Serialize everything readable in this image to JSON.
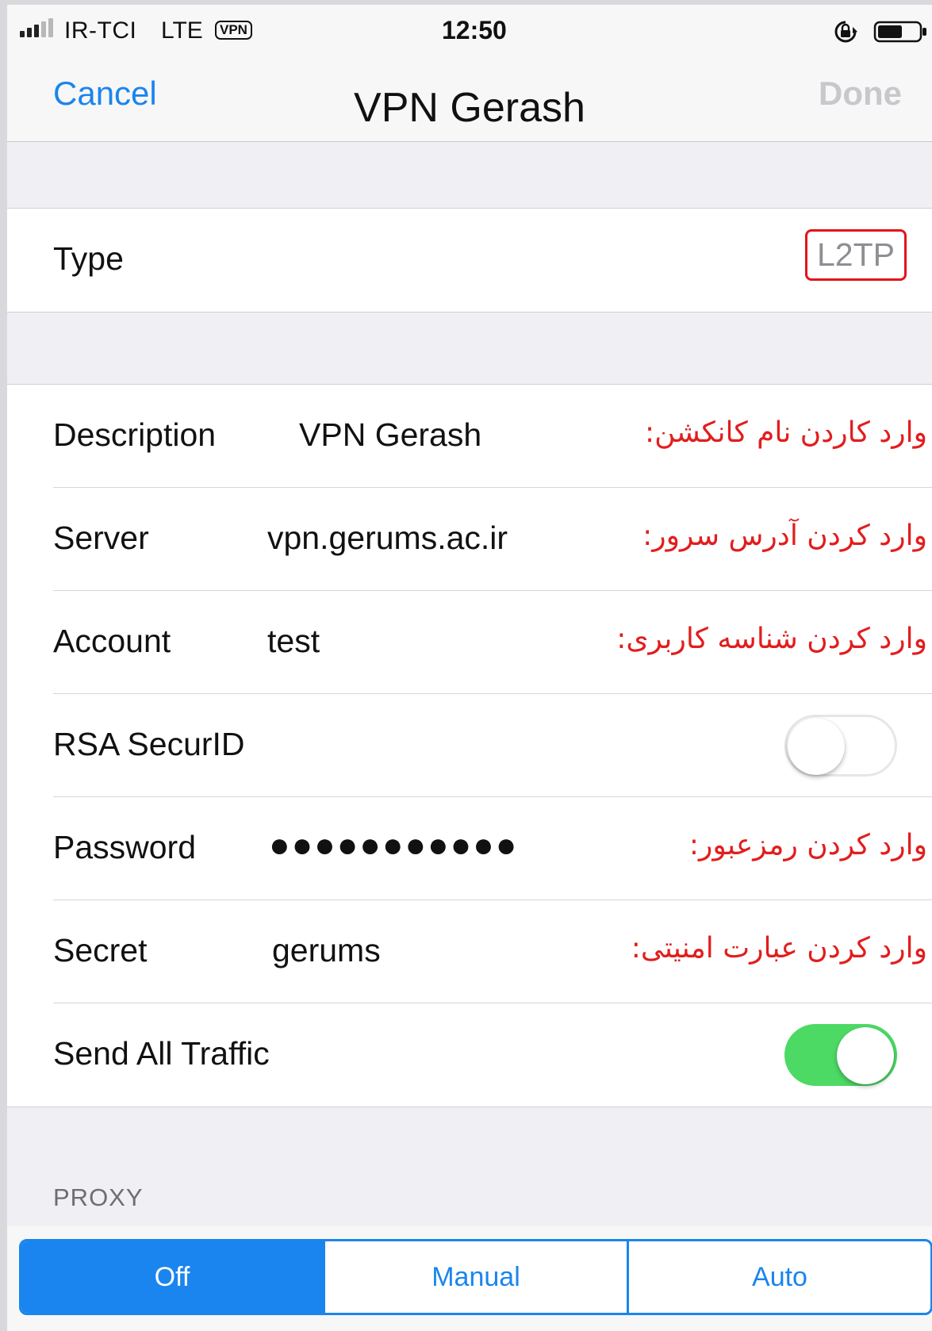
{
  "status_bar": {
    "carrier": "IR-TCI",
    "network": "LTE",
    "vpn_badge": "VPN",
    "time": "12:50",
    "icons": [
      "signal-icon",
      "rotation-lock-icon",
      "battery-icon"
    ]
  },
  "nav": {
    "cancel_label": "Cancel",
    "title": "VPN Gerash",
    "done_label": "Done"
  },
  "type_row": {
    "label": "Type",
    "value": "L2TP",
    "highlight_color": "#e3141c"
  },
  "fields": {
    "description": {
      "label": "Description",
      "value": "VPN Gerash",
      "hint": "وارد کاردن نام کانکشن:"
    },
    "server": {
      "label": "Server",
      "value": "vpn.gerums.ac.ir",
      "hint": "وارد کردن آدرس سرور:"
    },
    "account": {
      "label": "Account",
      "value": "test",
      "hint": "وارد کردن شناسه کاربری:"
    },
    "rsa": {
      "label": "RSA SecurID",
      "enabled": false
    },
    "password": {
      "label": "Password",
      "value": "●●●●●●●●●●●",
      "hint": "وارد کردن رمزعبور:"
    },
    "secret": {
      "label": "Secret",
      "value": "gerums",
      "hint": "وارد کردن عبارت امنیتی:"
    },
    "send_all_traffic": {
      "label": "Send All Traffic",
      "enabled": true
    }
  },
  "proxy": {
    "header": "PROXY",
    "options": [
      "Off",
      "Manual",
      "Auto"
    ],
    "selected": "Off"
  },
  "colors": {
    "accent": "#1a85ee",
    "hint_red": "#e21d1d",
    "toggle_on": "#4cd964"
  }
}
